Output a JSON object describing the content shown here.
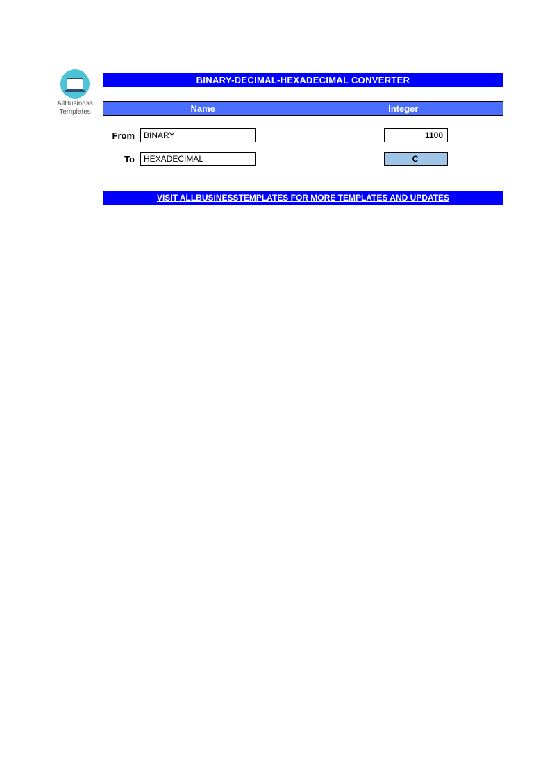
{
  "logo": {
    "line1": "AllBusiness",
    "line2": "Templates"
  },
  "title": "BINARY-DECIMAL-HEXADECIMAL CONVERTER",
  "headers": {
    "name": "Name",
    "integer": "Integer"
  },
  "rows": {
    "from": {
      "label": "From",
      "name": "BINARY",
      "value": "1100"
    },
    "to": {
      "label": "To",
      "name": "HEXADECIMAL",
      "value": "C"
    }
  },
  "footer": "VISIT ALLBUSINESSTEMPLATES FOR MORE TEMPLATES AND UPDATES"
}
